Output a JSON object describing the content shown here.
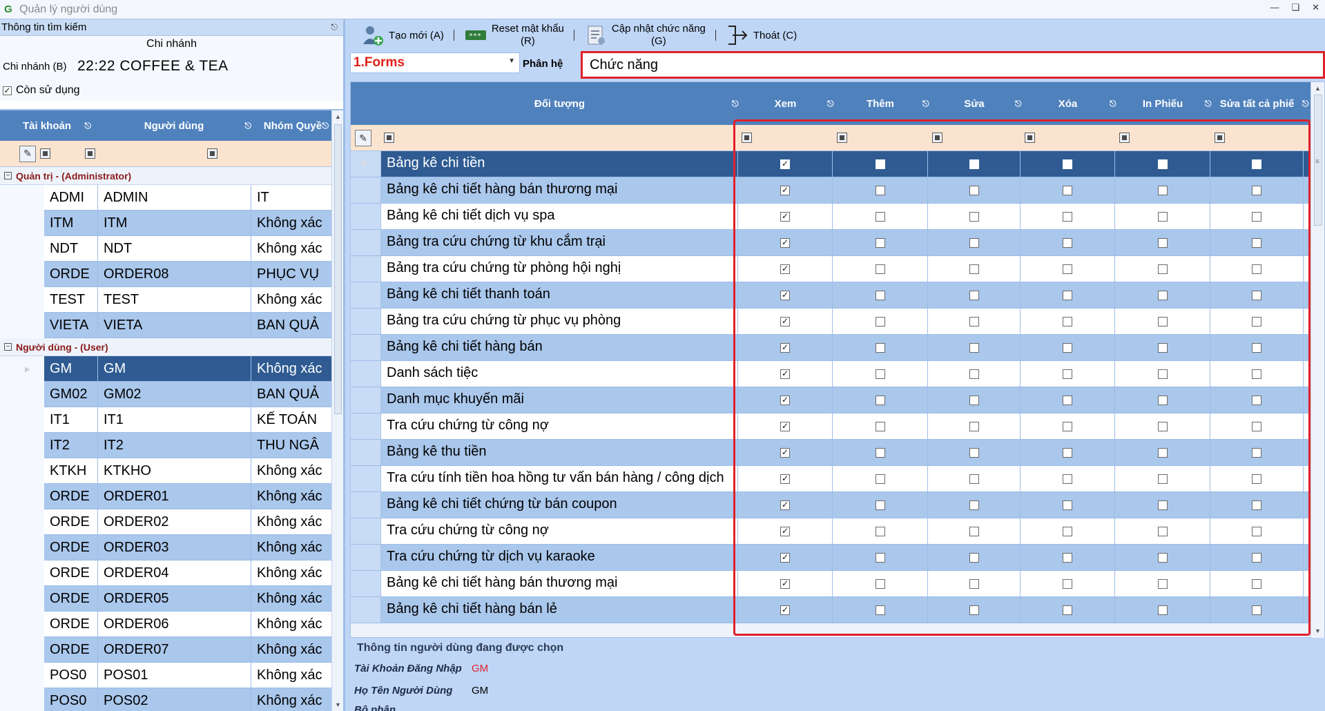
{
  "window": {
    "title": "Quản lý người dùng",
    "app_icon": "G"
  },
  "left_panel": {
    "header": "Thông tin tìm kiếm",
    "branch_title": "Chi nhánh",
    "branch_label": "Chi nhánh (B)",
    "branch_value": "22:22 COFFEE & TEA",
    "active_label": "Còn sử dụng",
    "active_checked": true,
    "columns": [
      "Tài khoản",
      "Người dùng",
      "Nhóm Quyề"
    ],
    "groups": [
      {
        "name": "Quản trị - (Administrator)",
        "rows": [
          [
            "ADMI",
            "ADMIN",
            "IT"
          ],
          [
            "ITM",
            "ITM",
            "Không xác"
          ],
          [
            "NDT",
            "NDT",
            "Không xác"
          ],
          [
            "ORDE",
            "ORDER08",
            "PHỤC VỤ"
          ],
          [
            "TEST",
            "TEST",
            "Không xác"
          ],
          [
            "VIETA",
            "VIETA",
            "BAN QUẢ"
          ]
        ]
      },
      {
        "name": "Người dùng - (User)",
        "rows": [
          [
            "GM",
            "GM",
            "Không xác"
          ],
          [
            "GM02",
            "GM02",
            "BAN QUẢ"
          ],
          [
            "IT1",
            "IT1",
            "KẾ TOÁN"
          ],
          [
            "IT2",
            "IT2",
            "THU NGÂ"
          ],
          [
            "KTKH",
            "KTKHO",
            "Không xác"
          ],
          [
            "ORDE",
            "ORDER01",
            "Không xác"
          ],
          [
            "ORDE",
            "ORDER02",
            "Không xác"
          ],
          [
            "ORDE",
            "ORDER03",
            "Không xác"
          ],
          [
            "ORDE",
            "ORDER04",
            "Không xác"
          ],
          [
            "ORDE",
            "ORDER05",
            "Không xác"
          ],
          [
            "ORDE",
            "ORDER06",
            "Không xác"
          ],
          [
            "ORDE",
            "ORDER07",
            "Không xác"
          ],
          [
            "POS0",
            "POS01",
            "Không xác"
          ],
          [
            "POS0",
            "POS02",
            "Không xác"
          ]
        ]
      }
    ],
    "selected_account": "GM"
  },
  "toolbar": {
    "new_label": "Tạo mới (A)",
    "reset_label_1": "Reset mật khẩu",
    "reset_label_2": "(R)",
    "update_label_1": "Cập nhật chức năng",
    "update_label_2": "(G)",
    "exit_label": "Thoát (C)"
  },
  "module": {
    "selected": "1.Forms",
    "label": "Phân hệ",
    "function_value": "Chức năng"
  },
  "permissions": {
    "columns": [
      "Đối tượng",
      "Xem",
      "Thêm",
      "Sửa",
      "Xóa",
      "In Phiếu",
      "Sửa tất cả phiế"
    ],
    "rows": [
      {
        "name": "Bảng kê chi tiền",
        "checks": [
          true,
          false,
          false,
          false,
          false,
          false
        ]
      },
      {
        "name": "Bảng kê chi tiết hàng bán thương mại",
        "checks": [
          true,
          false,
          false,
          false,
          false,
          false
        ]
      },
      {
        "name": "Bảng kê chi tiết dịch vụ spa",
        "checks": [
          true,
          false,
          false,
          false,
          false,
          false
        ]
      },
      {
        "name": "Bảng tra cứu chứng từ khu cắm trại",
        "checks": [
          true,
          false,
          false,
          false,
          false,
          false
        ]
      },
      {
        "name": "Bảng tra cứu chứng từ phòng hội nghị",
        "checks": [
          true,
          false,
          false,
          false,
          false,
          false
        ]
      },
      {
        "name": "Bảng kê chi tiết thanh toán",
        "checks": [
          true,
          false,
          false,
          false,
          false,
          false
        ]
      },
      {
        "name": "Bảng tra cứu chứng từ phục vụ phòng",
        "checks": [
          true,
          false,
          false,
          false,
          false,
          false
        ]
      },
      {
        "name": "Bảng kê chi tiết hàng bán",
        "checks": [
          true,
          false,
          false,
          false,
          false,
          false
        ]
      },
      {
        "name": "Danh sách tiệc",
        "checks": [
          true,
          false,
          false,
          false,
          false,
          false
        ]
      },
      {
        "name": "Danh mục khuyến mãi",
        "checks": [
          true,
          false,
          false,
          false,
          false,
          false
        ]
      },
      {
        "name": "Tra cứu chứng từ công nợ",
        "checks": [
          true,
          false,
          false,
          false,
          false,
          false
        ]
      },
      {
        "name": "Bảng kê thu tiền",
        "checks": [
          true,
          false,
          false,
          false,
          false,
          false
        ]
      },
      {
        "name": "Tra cứu tính tiền hoa hồng tư vấn bán hàng / công dịch",
        "checks": [
          true,
          false,
          false,
          false,
          false,
          false
        ]
      },
      {
        "name": "Bảng kê chi tiết chứng từ bán coupon",
        "checks": [
          true,
          false,
          false,
          false,
          false,
          false
        ]
      },
      {
        "name": "Tra cứu chứng từ công nợ",
        "checks": [
          true,
          false,
          false,
          false,
          false,
          false
        ]
      },
      {
        "name": "Tra cứu chứng từ dịch vụ karaoke",
        "checks": [
          true,
          false,
          false,
          false,
          false,
          false
        ]
      },
      {
        "name": "Bảng kê chi tiết hàng bán thương mại",
        "checks": [
          true,
          false,
          false,
          false,
          false,
          false
        ]
      },
      {
        "name": "Bảng kê chi tiết hàng bán lẻ",
        "checks": [
          true,
          false,
          false,
          false,
          false,
          false
        ]
      }
    ],
    "selected_index": 0
  },
  "user_info": {
    "title": "Thông tin người dùng đang được chọn",
    "login_label": "Tài Khoản Đăng Nhập",
    "login_value": "GM",
    "name_label": "Họ Tên Người Dùng",
    "name_value": "GM",
    "dept_label": "Bộ phận",
    "dept_value": ""
  },
  "colors": {
    "header_blue": "#4f81bd",
    "row_alt": "#aac7ec",
    "row_selected": "#2f5b92",
    "filter_row": "#fbe4cf",
    "highlight_red": "#e0202a",
    "login_value": "#e0202a"
  },
  "icons": {
    "new": "user-add-icon",
    "reset": "password-reset-icon",
    "update": "document-list-icon",
    "exit": "exit-icon"
  }
}
